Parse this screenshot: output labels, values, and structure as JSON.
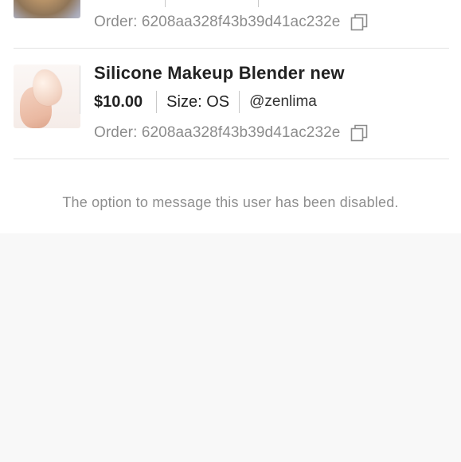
{
  "orders": [
    {
      "title": "",
      "price": "",
      "size": "",
      "seller": "",
      "order_text": "Order: 6208aa328f43b39d41ac232e",
      "thumbnail": "product-photo-1"
    },
    {
      "title": "Silicone Makeup Blender new",
      "price": "$10.00",
      "size": "Size: OS",
      "seller": "@zenlima",
      "order_text": "Order: 6208aa328f43b39d41ac232e",
      "thumbnail": "silicone-blender-photo"
    }
  ],
  "icons": {
    "copy": "copy-icon"
  },
  "message_note": "The option to message this user has been disabled.",
  "colors": {
    "divider": "#e3e3e3",
    "muted_text": "#8c8c8c",
    "primary_text": "#222222",
    "background": "#f8f8f8",
    "panel": "#ffffff"
  }
}
